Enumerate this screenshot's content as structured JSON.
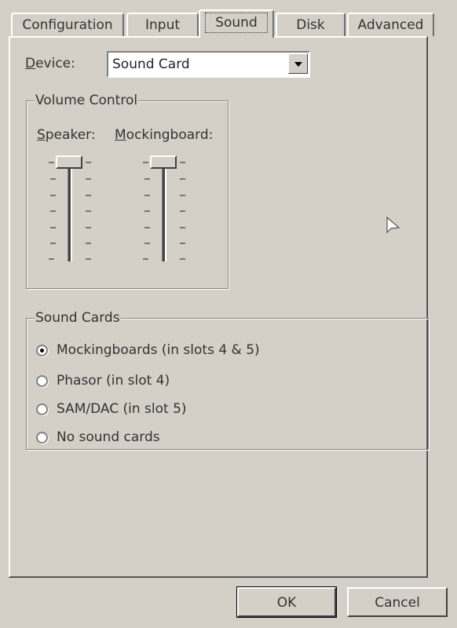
{
  "tabs": [
    {
      "label": "Configuration",
      "active": false
    },
    {
      "label": "Input",
      "active": false
    },
    {
      "label": "Sound",
      "active": true
    },
    {
      "label": "Disk",
      "active": false
    },
    {
      "label": "Advanced",
      "active": false
    }
  ],
  "device": {
    "label_prefix": "",
    "label_accel": "D",
    "label_rest": "evice:",
    "value": "Sound Card"
  },
  "volume_control": {
    "title": "Volume Control",
    "speaker": {
      "label_accel": "S",
      "label_rest": "peaker:",
      "level": "max"
    },
    "mockingboard": {
      "label_accel": "M",
      "label_rest": "ockingboard:",
      "level": "max"
    }
  },
  "sound_cards": {
    "title": "Sound Cards",
    "options": [
      {
        "label": "Mockingboards (in slots 4 & 5)",
        "selected": true
      },
      {
        "label": "Phasor (in slot 4)",
        "selected": false
      },
      {
        "label": "SAM/DAC (in slot 5)",
        "selected": false
      },
      {
        "label": "No sound cards",
        "selected": false
      }
    ]
  },
  "buttons": {
    "ok": "OK",
    "cancel": "Cancel"
  }
}
